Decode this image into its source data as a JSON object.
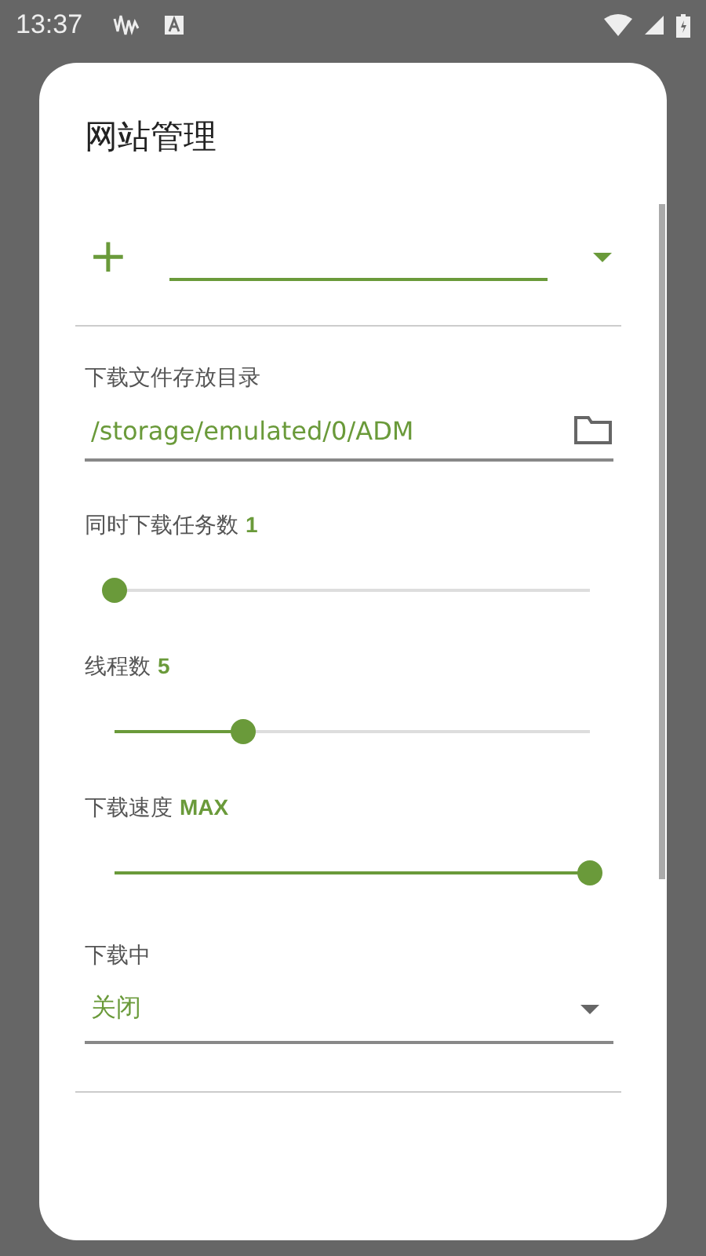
{
  "status_bar": {
    "time": "13:37"
  },
  "dialog": {
    "title": "网站管理",
    "site_add": {
      "symbol": "+"
    },
    "directory": {
      "label": "下载文件存放目录",
      "value": "/storage/emulated/0/ADM"
    },
    "sliders": [
      {
        "label": "同时下载任务数",
        "reading": "1",
        "level": 0
      },
      {
        "label": "线程数",
        "reading": "5",
        "level": 0.27
      },
      {
        "label": "下载速度",
        "reading": "MAX",
        "level": 1
      }
    ],
    "downloading": {
      "label": "下载中",
      "value": "关闭"
    }
  }
}
